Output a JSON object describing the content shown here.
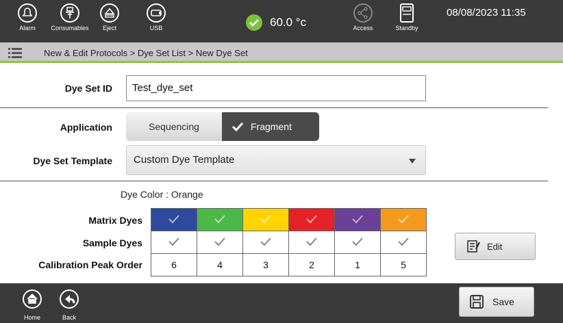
{
  "topbar": {
    "alarm_label": "Alarm",
    "consumables_label": "Consumables",
    "eject_label": "Eject",
    "usb_label": "USB",
    "temperature": "60.0 °c",
    "access_label": "Access",
    "standby_label": "Standby",
    "datetime": "08/08/2023 11:35"
  },
  "breadcrumb": "New & Edit Protocols > Dye Set List > New Dye Set",
  "form": {
    "dye_set_id_label": "Dye Set ID",
    "dye_set_id_value": "Test_dye_set",
    "application_label": "Application",
    "application_options": [
      "Sequencing",
      "Fragment"
    ],
    "application_selected": "Fragment",
    "template_label": "Dye Set Template",
    "template_value": "Custom Dye Template"
  },
  "dyes": {
    "dye_color_text": "Dye Color : Orange",
    "matrix_label": "Matrix Dyes",
    "sample_label": "Sample Dyes",
    "calibration_label": "Calibration Peak Order",
    "colors": [
      "#2e4a9e",
      "#4cb848",
      "#ffd400",
      "#e4222a",
      "#6a3f98",
      "#f39a1e"
    ],
    "calibration_order": [
      "6",
      "4",
      "3",
      "2",
      "1",
      "5"
    ],
    "edit_label": "Edit"
  },
  "bottombar": {
    "home_label": "Home",
    "back_label": "Back",
    "save_label": "Save"
  }
}
